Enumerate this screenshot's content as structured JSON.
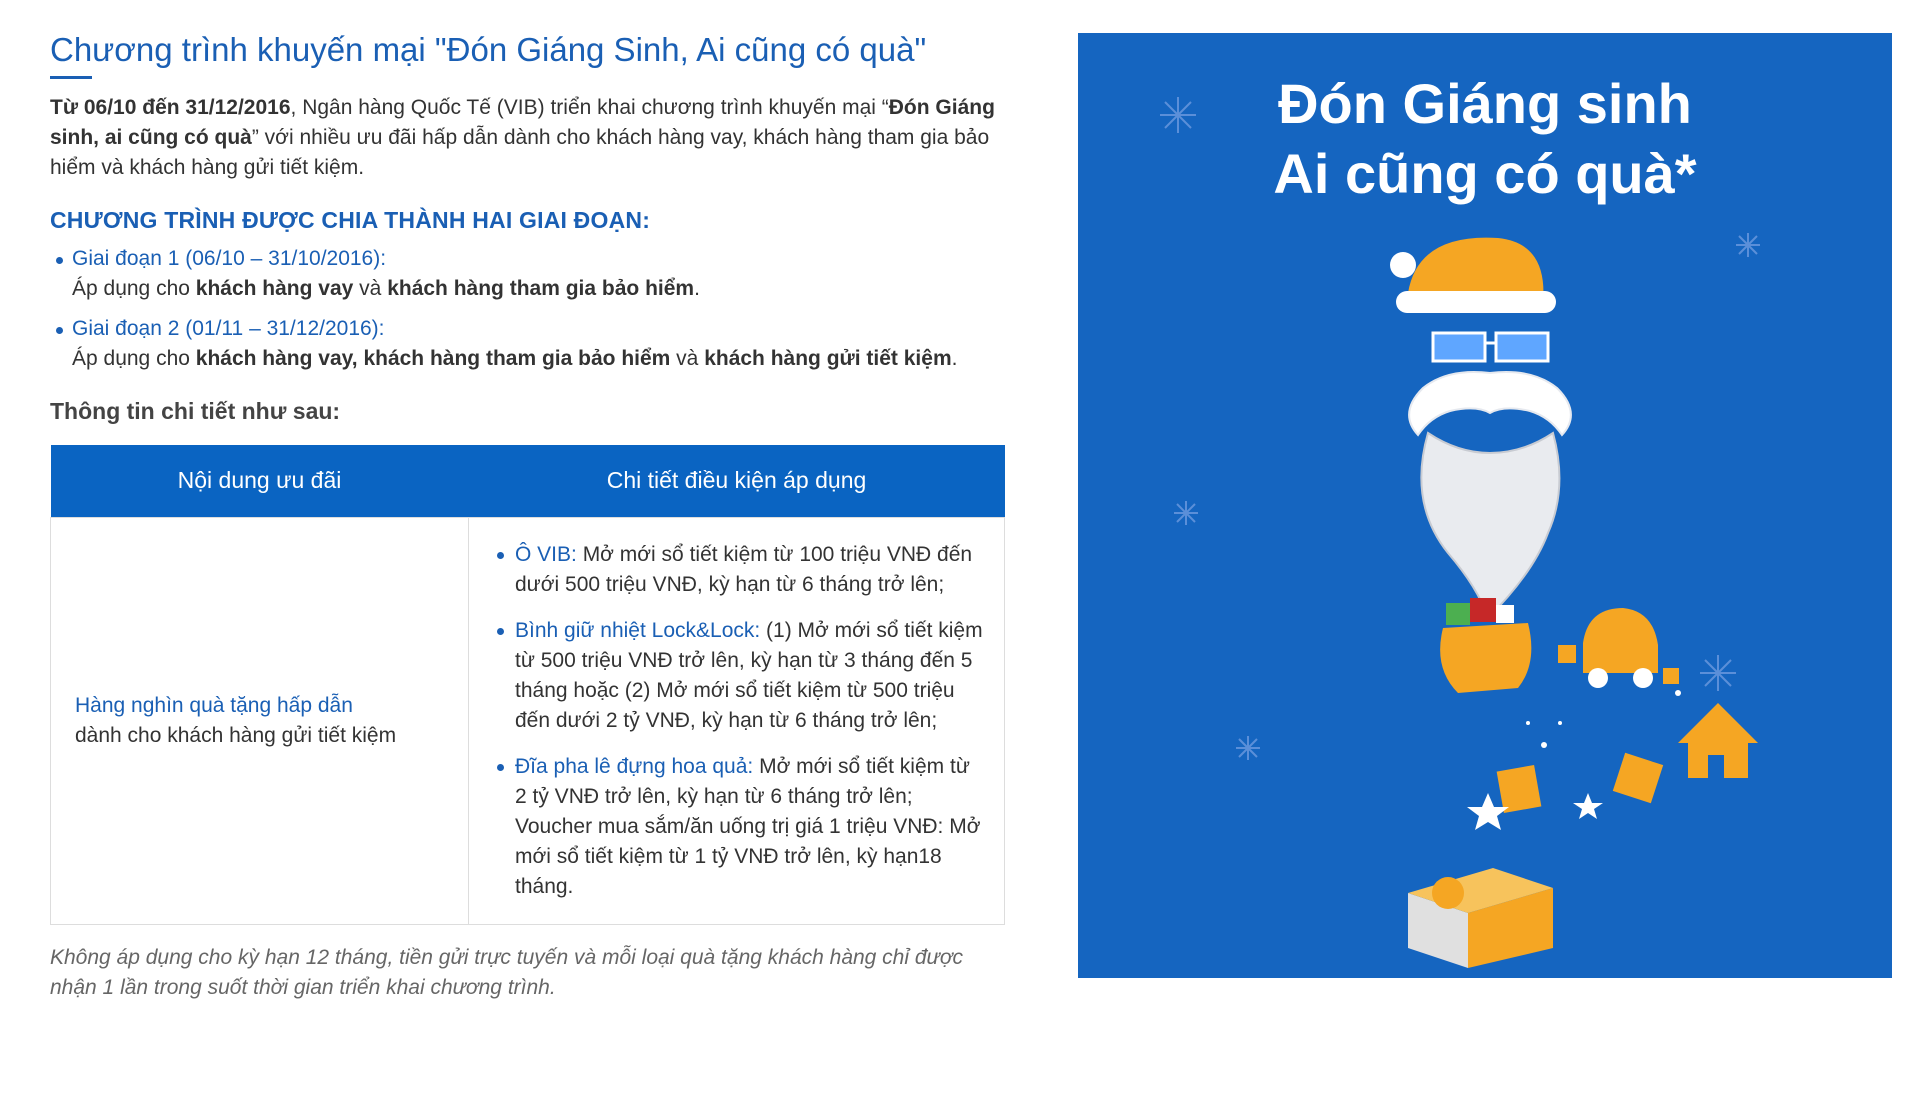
{
  "article": {
    "title": "Chương trình khuyến mại \"Đón Giáng Sinh, Ai cũng có quà\"",
    "intro": {
      "date_range": "Từ 06/10 đến 31/12/2016",
      "part1": ", Ngân hàng Quốc Tế (VIB) triển khai chương trình khuyến mại “",
      "program_name": "Đón Giáng sinh, ai cũng có quà",
      "part2": "” với nhiều ưu đãi hấp dẫn dành cho khách hàng vay, khách hàng tham gia bảo hiểm và khách hàng gửi tiết kiệm."
    },
    "phases_heading": "CHƯƠNG TRÌNH ĐƯỢC CHIA THÀNH  HAI GIAI ĐOẠN:",
    "phases": [
      {
        "title": "Giai đoạn 1 (06/10 – 31/10/2016):",
        "prefix": "Áp dụng cho ",
        "bold1": "khách hàng vay",
        "joiner": " và ",
        "bold2": "khách hàng tham gia bảo hiểm",
        "suffix": "."
      },
      {
        "title": "Giai đoạn 2 (01/11 – 31/12/2016):",
        "prefix": "Áp dụng cho ",
        "bold1": "khách hàng vay, khách hàng tham gia bảo hiểm",
        "joiner": " và ",
        "bold2": "khách hàng gửi tiết kiệm",
        "suffix": "."
      }
    ],
    "details_heading": "Thông tin chi tiết như sau:",
    "table": {
      "headers": [
        "Nội dung ưu đãi",
        "Chi tiết điều kiện áp dụng"
      ],
      "offer_title": "Hàng nghìn quà tặng hấp dẫn",
      "offer_subtitle": "dành cho khách hàng gửi tiết kiệm",
      "items": [
        {
          "label": "Ô VIB:",
          "text": " Mở mới sổ tiết kiệm từ 100 triệu VNĐ đến dưới 500 triệu VNĐ, kỳ hạn từ 6 tháng trở lên;"
        },
        {
          "label": "Bình giữ nhiệt Lock&Lock:",
          "text": " (1) Mở mới sổ tiết kiệm từ 500 triệu VNĐ trở lên, kỳ hạn từ 3 tháng đến 5 tháng hoặc (2) Mở mới sổ tiết kiệm từ 500 triệu đến dưới 2 tỷ VNĐ, kỳ hạn từ 6 tháng trở lên;"
        },
        {
          "label": "Đĩa pha lê đựng hoa quả:",
          "text": " Mở mới sổ tiết kiệm từ 2 tỷ VNĐ trở lên, kỳ hạn từ 6 tháng trở lên; Voucher mua sắm/ăn uống trị giá 1 triệu VNĐ: Mở mới sổ tiết kiệm từ 1 tỷ VNĐ trở lên, kỳ hạn18 tháng."
        }
      ]
    },
    "footnote": "Không áp dụng cho kỳ hạn 12 tháng, tiền gửi trực tuyến và mỗi loại quà tặng khách hàng chỉ được nhận 1 lần trong suốt thời gian triển khai chương trình."
  },
  "banner": {
    "line1": "Đón Giáng sinh",
    "line2": "Ai cũng có quà*",
    "background_color": "#1565c0",
    "accent_color": "#f5a623",
    "illustration": "santa-face-with-gifts"
  }
}
